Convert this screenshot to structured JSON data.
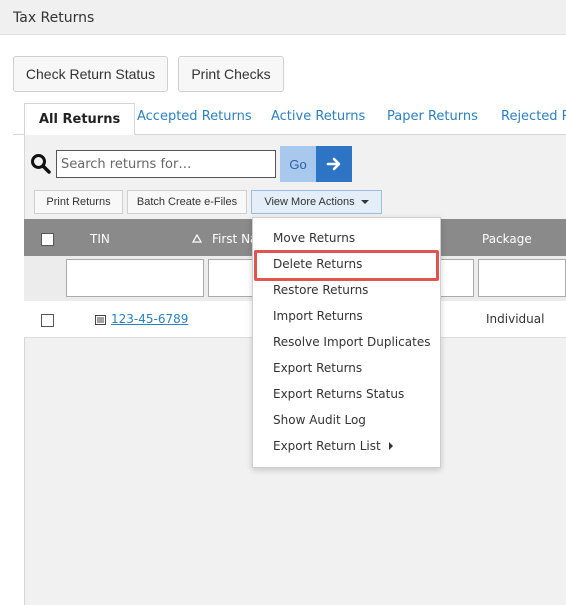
{
  "window": {
    "title": "Tax Returns"
  },
  "toolbar": {
    "check_status_label": "Check Return Status",
    "print_checks_label": "Print Checks"
  },
  "tabs": [
    {
      "label": "All Returns",
      "active": true
    },
    {
      "label": "Accepted Returns"
    },
    {
      "label": "Active Returns"
    },
    {
      "label": "Paper Returns"
    },
    {
      "label": "Rejected Re"
    }
  ],
  "search": {
    "placeholder": "Search returns for…",
    "value": "",
    "go_label": "Go"
  },
  "actions": {
    "print_returns": "Print Returns",
    "batch_create": "Batch Create e-Files",
    "view_more": "View More Actions"
  },
  "table": {
    "columns": {
      "tin": "TIN",
      "first_name": "First Na",
      "package": "Package"
    },
    "rows": [
      {
        "tin": "123-45-6789",
        "package": "Individual"
      }
    ]
  },
  "dropdown": {
    "items": [
      "Move Returns",
      "Delete Returns",
      "Restore Returns",
      "Import Returns",
      "Resolve Import Duplicates",
      "Export Returns",
      "Export Returns Status",
      "Show Audit Log",
      "Export Return List"
    ]
  },
  "colors": {
    "accent": "#2d74c4",
    "link": "#2d7fbf",
    "highlight": "#e05552",
    "header": "#8a8a8a"
  }
}
